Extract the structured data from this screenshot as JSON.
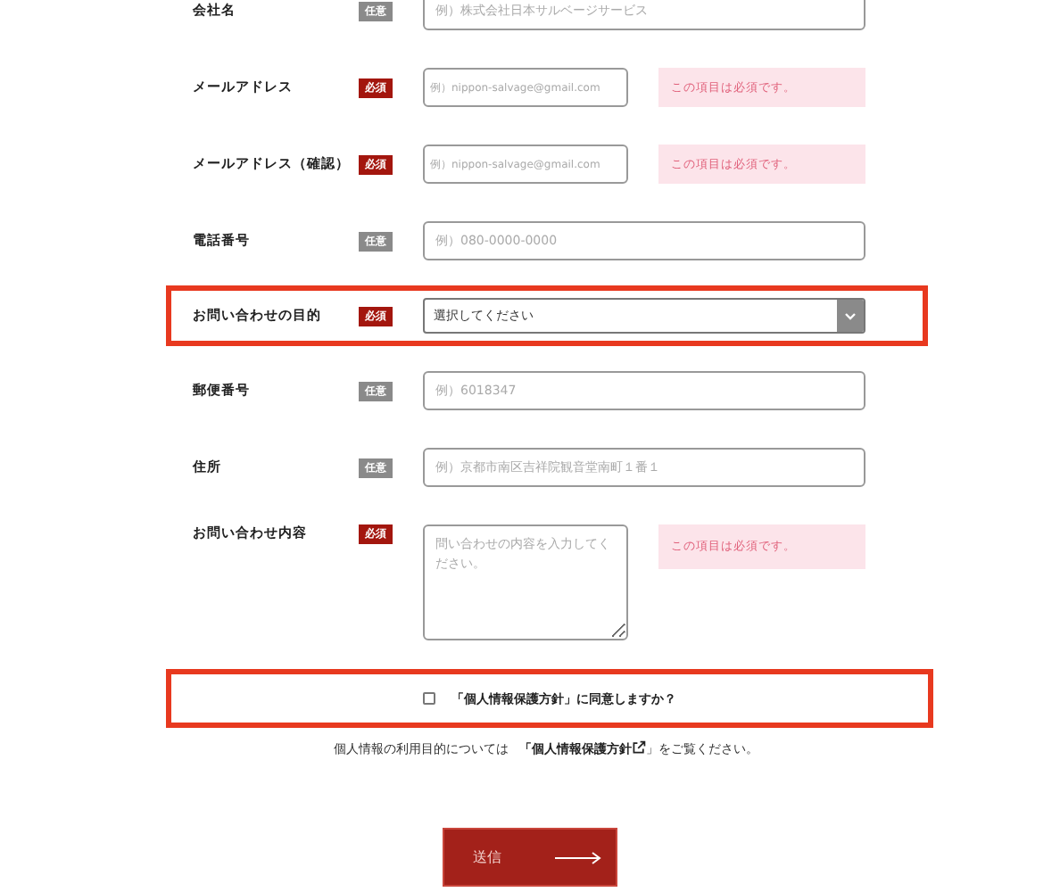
{
  "fields": [
    {
      "kind": "text",
      "label": "会社名",
      "required": false,
      "badge": "任意",
      "placeholder": "例）株式会社日本サルベージサービス",
      "wide": true,
      "highlighted": false
    },
    {
      "kind": "text",
      "label": "メールアドレス",
      "required": true,
      "badge": "必須",
      "placeholder": "例）nippon-salvage@gmail.com",
      "wide": false,
      "error": "この項目は必須です。",
      "highlighted": false
    },
    {
      "kind": "text",
      "label": "メールアドレス（確認）",
      "required": true,
      "badge": "必須",
      "placeholder": "例）nippon-salvage@gmail.com",
      "wide": false,
      "error": "この項目は必須です。",
      "highlighted": false
    },
    {
      "kind": "text",
      "label": "電話番号",
      "required": false,
      "badge": "任意",
      "placeholder": "例）080-0000-0000",
      "wide": true,
      "highlighted": false
    },
    {
      "kind": "select",
      "label": "お問い合わせの目的",
      "required": true,
      "badge": "必須",
      "value": "選択してください",
      "wide": true,
      "highlighted": true
    },
    {
      "kind": "text",
      "label": "郵便番号",
      "required": false,
      "badge": "任意",
      "placeholder": "例）6018347",
      "wide": true,
      "highlighted": false
    },
    {
      "kind": "text",
      "label": "住所",
      "required": false,
      "badge": "任意",
      "placeholder": "例）京都市南区吉祥院観音堂南町１番１",
      "wide": true,
      "highlighted": false
    },
    {
      "kind": "textarea",
      "label": "お問い合わせ内容",
      "required": true,
      "badge": "必須",
      "placeholder": "問い合わせの内容を入力してください。",
      "wide": false,
      "error": "この項目は必須です。",
      "highlighted": false
    }
  ],
  "agreement": {
    "label": "「個人情報保護方針」に同意しますか？",
    "checked": false,
    "highlighted": true
  },
  "note": {
    "before": "個人情報の利用目的については",
    "link": "「個人情報保護方針",
    "after": "」をご覧ください。"
  },
  "submit": "送信"
}
